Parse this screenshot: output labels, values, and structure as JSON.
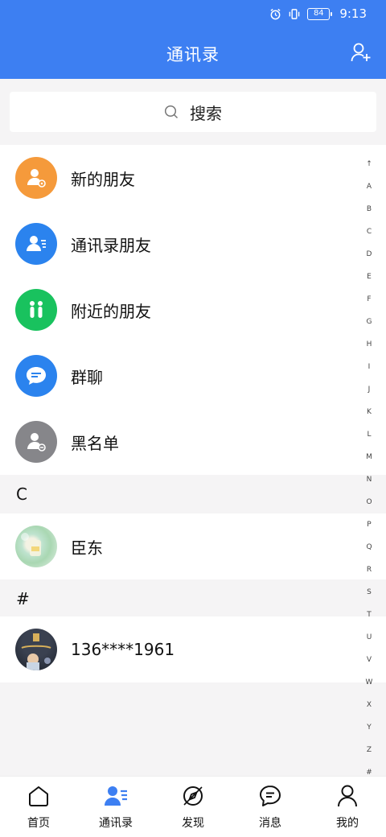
{
  "status": {
    "time": "9:13",
    "battery": "84"
  },
  "header": {
    "title": "通讯录"
  },
  "search": {
    "label": "搜索"
  },
  "features": [
    {
      "label": "新的朋友",
      "icon": "new-friend-icon",
      "color": "#f59a3b"
    },
    {
      "label": "通讯录朋友",
      "icon": "contacts-friend-icon",
      "color": "#2b83ee"
    },
    {
      "label": "附近的朋友",
      "icon": "nearby-icon",
      "color": "#19c25e"
    },
    {
      "label": "群聊",
      "icon": "group-chat-icon",
      "color": "#2b83ee"
    },
    {
      "label": "黑名单",
      "icon": "blacklist-icon",
      "color": "#86868a"
    }
  ],
  "sections": [
    {
      "letter": "C",
      "contacts": [
        {
          "name": "臣东"
        }
      ]
    },
    {
      "letter": "#",
      "contacts": [
        {
          "name": "136****1961"
        }
      ]
    }
  ],
  "index": [
    "↑",
    "A",
    "B",
    "C",
    "D",
    "E",
    "F",
    "G",
    "H",
    "I",
    "J",
    "K",
    "L",
    "M",
    "N",
    "O",
    "P",
    "Q",
    "R",
    "S",
    "T",
    "U",
    "V",
    "W",
    "X",
    "Y",
    "Z",
    "#"
  ],
  "tabs": [
    {
      "label": "首页",
      "icon": "home-icon"
    },
    {
      "label": "通讯录",
      "icon": "contacts-tab-icon",
      "active": true
    },
    {
      "label": "发现",
      "icon": "discover-icon"
    },
    {
      "label": "消息",
      "icon": "message-icon"
    },
    {
      "label": "我的",
      "icon": "profile-icon"
    }
  ],
  "colors": {
    "brand": "#3d7ff2",
    "background": "#f5f4f5"
  }
}
